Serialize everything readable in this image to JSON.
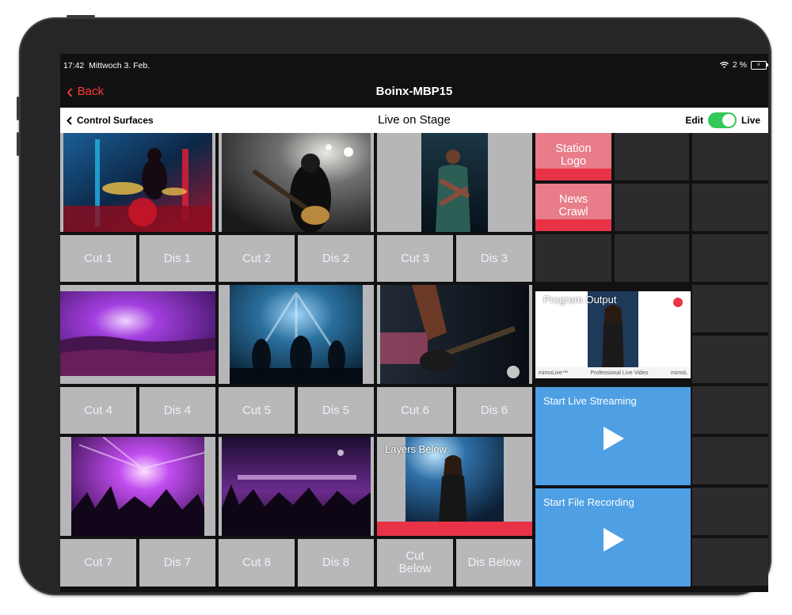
{
  "status": {
    "time": "17:42",
    "date": "Mittwoch 3. Feb.",
    "battery": "2 %"
  },
  "nav": {
    "back": "Back",
    "title": "Boinx-MBP15"
  },
  "subbar": {
    "back": "Control Surfaces",
    "title": "Live on Stage",
    "edit": "Edit",
    "live": "Live",
    "live_on": true
  },
  "buttons": {
    "cut1": "Cut 1",
    "dis1": "Dis 1",
    "cut2": "Cut 2",
    "dis2": "Dis 2",
    "cut3": "Cut 3",
    "dis3": "Dis 3",
    "cut4": "Cut 4",
    "dis4": "Dis 4",
    "cut5": "Cut 5",
    "dis5": "Dis 5",
    "cut6": "Cut 6",
    "dis6": "Dis 6",
    "cut7": "Cut 7",
    "dis7": "Dis 7",
    "cut8": "Cut 8",
    "dis8": "Dis 8",
    "cut_below": "Cut Below",
    "dis_below": "Dis Below"
  },
  "layers": {
    "station_logo": "Station Logo",
    "news_crawl": "News Crawl",
    "layers_below": "Layers Below"
  },
  "program": {
    "label": "Program Output",
    "footer_left": "mimoLive™",
    "footer_mid": "Professional Live Video",
    "footer_right": "mimoL"
  },
  "actions": {
    "streaming": "Start Live Streaming",
    "recording": "Start File Recording"
  },
  "colors": {
    "accent_red": "#ff3b30",
    "toggle_green": "#34c759",
    "layer_pink": "#e87c89",
    "layer_active": "#e83347",
    "action_blue": "#4e9fe4",
    "button_grey": "#b8b8bb"
  },
  "icons": {
    "play": "play-icon",
    "back": "chevron-left-icon",
    "wifi": "wifi-icon",
    "battery": "battery-icon"
  }
}
